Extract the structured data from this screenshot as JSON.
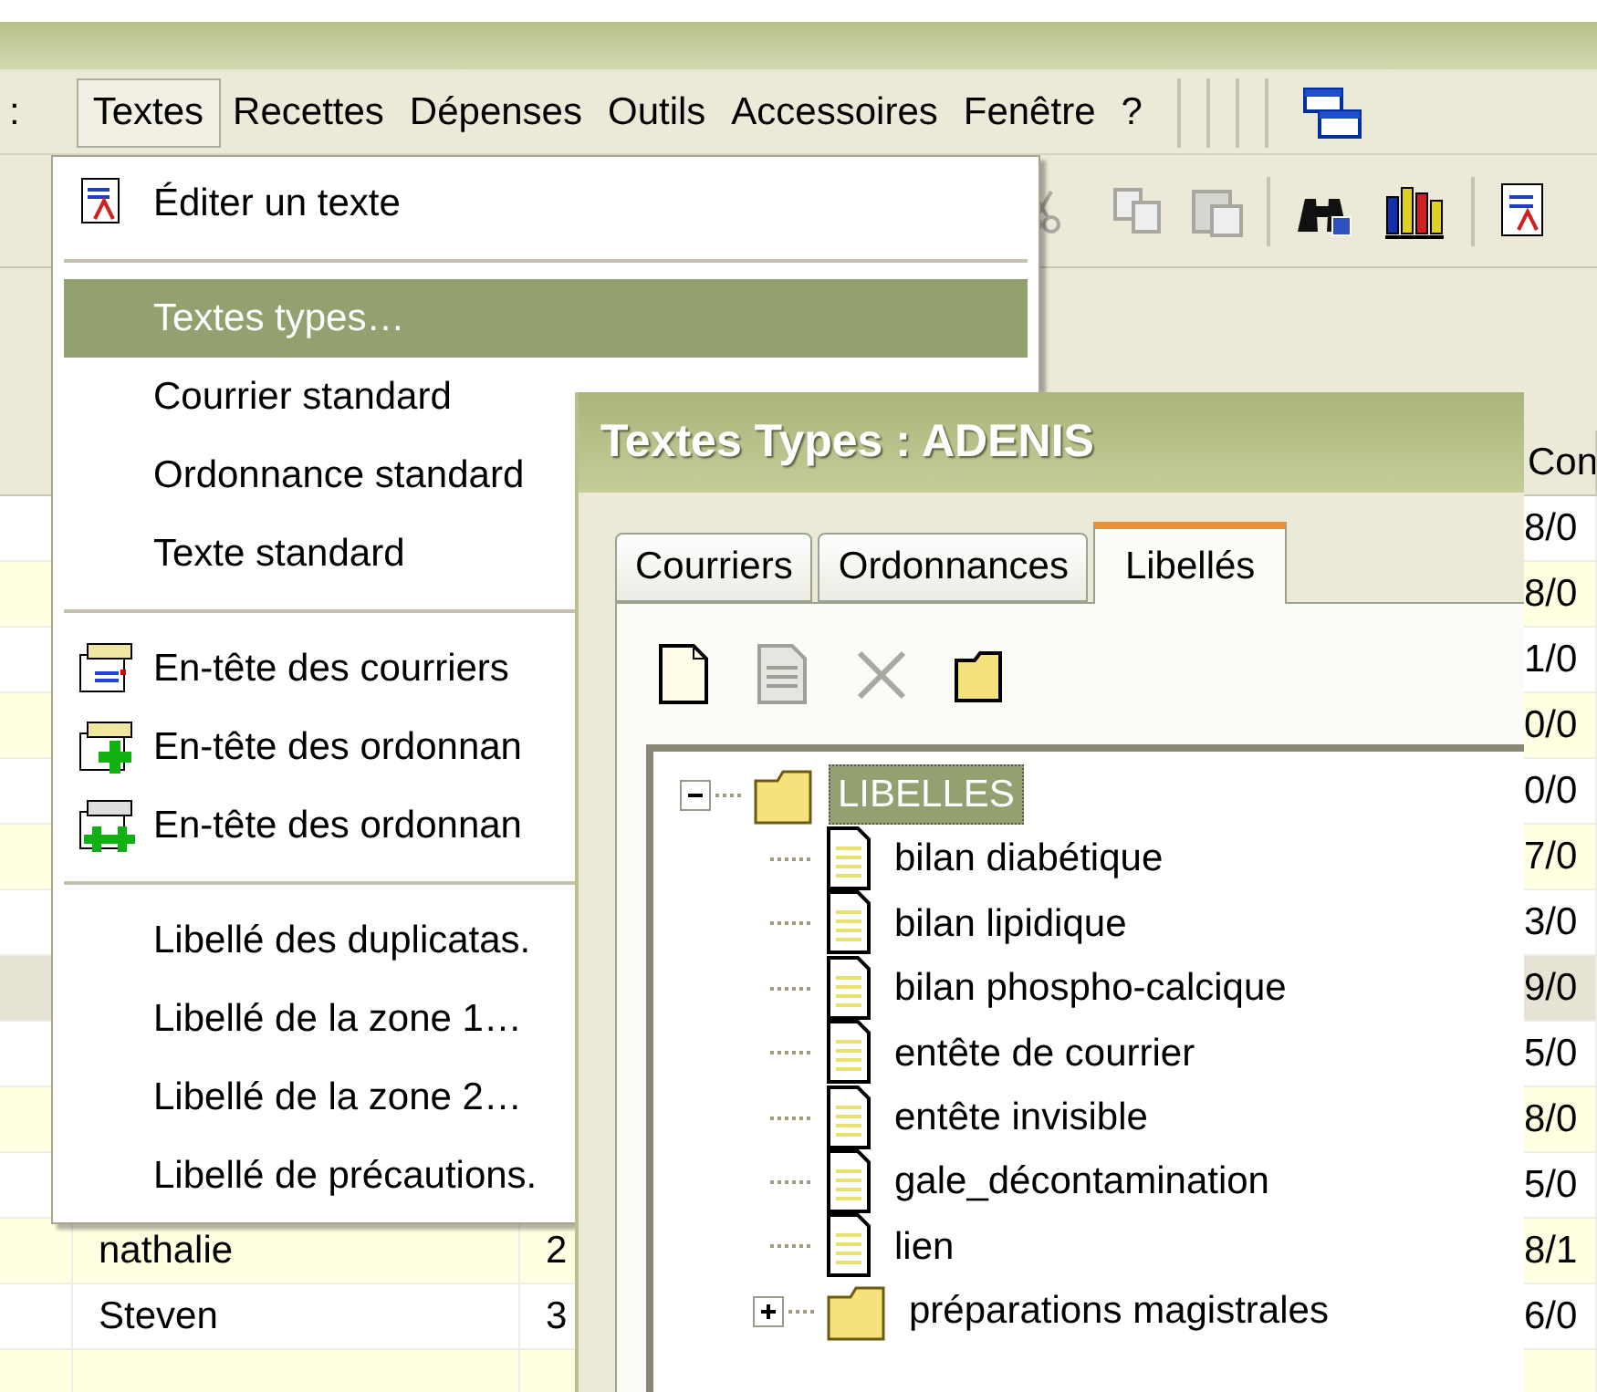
{
  "menubar": [
    {
      "label": ":",
      "open": false
    },
    {
      "label": "Textes",
      "open": true
    },
    {
      "label": "Recettes",
      "open": false
    },
    {
      "label": "Dépenses",
      "open": false
    },
    {
      "label": "Outils",
      "open": false
    },
    {
      "label": "Accessoires",
      "open": false
    },
    {
      "label": "Fenêtre",
      "open": false
    },
    {
      "label": "?",
      "open": false
    }
  ],
  "table": {
    "columns": [
      "",
      "",
      "",
      "",
      "Con"
    ],
    "rows": [
      {
        "cells": [
          "",
          "",
          "",
          "",
          "8/0"
        ],
        "highlighted": false,
        "selected": false
      },
      {
        "cells": [
          "",
          "",
          "",
          "",
          "8/0"
        ],
        "highlighted": true,
        "selected": false
      },
      {
        "cells": [
          "",
          "",
          "",
          "",
          "1/0"
        ],
        "highlighted": false,
        "selected": false
      },
      {
        "cells": [
          "",
          "",
          "",
          "",
          "0/0"
        ],
        "highlighted": true,
        "selected": false
      },
      {
        "cells": [
          "",
          "",
          "",
          "",
          "0/0"
        ],
        "highlighted": false,
        "selected": false
      },
      {
        "cells": [
          "",
          "",
          "",
          "",
          "7/0"
        ],
        "highlighted": true,
        "selected": false
      },
      {
        "cells": [
          "",
          "",
          "",
          "",
          "3/0"
        ],
        "highlighted": false,
        "selected": false
      },
      {
        "cells": [
          "",
          "",
          "",
          "",
          "9/0"
        ],
        "highlighted": false,
        "selected": true
      },
      {
        "cells": [
          "",
          "",
          "",
          "",
          "5/0"
        ],
        "highlighted": false,
        "selected": false
      },
      {
        "cells": [
          "",
          "",
          "",
          "",
          "8/0"
        ],
        "highlighted": true,
        "selected": false
      },
      {
        "cells": [
          "",
          "",
          "",
          "",
          "5/0"
        ],
        "highlighted": false,
        "selected": false
      },
      {
        "cells": [
          "",
          "nathalie",
          "2",
          "",
          "8/1"
        ],
        "highlighted": true,
        "selected": false
      },
      {
        "cells": [
          "",
          "Steven",
          "3",
          "",
          "6/0"
        ],
        "highlighted": false,
        "selected": false
      },
      {
        "cells": [
          "",
          "",
          "",
          "",
          ""
        ],
        "highlighted": true,
        "selected": false
      }
    ]
  },
  "menu": {
    "items": [
      {
        "kind": "document",
        "label": "Éditer un texte",
        "selected": false
      },
      {
        "kind": "separator"
      },
      {
        "kind": "item",
        "label": "Textes types…",
        "selected": true
      },
      {
        "kind": "item",
        "label": "Courrier standard",
        "selected": false
      },
      {
        "kind": "item",
        "label": "Ordonnance standard",
        "selected": false
      },
      {
        "kind": "item",
        "label": "Texte standard",
        "selected": false
      },
      {
        "kind": "separator"
      },
      {
        "kind": "header",
        "label": "En-tête des courriers",
        "selected": false
      },
      {
        "kind": "header_add",
        "label": "En-tête des ordonnan",
        "selected": false
      },
      {
        "kind": "header_add_double",
        "label": "En-tête des ordonnan",
        "selected": false
      },
      {
        "kind": "separator"
      },
      {
        "kind": "item",
        "label": "Libellé des duplicatas.",
        "selected": false
      },
      {
        "kind": "item",
        "label": "Libellé de la zone 1…",
        "selected": false
      },
      {
        "kind": "item",
        "label": "Libellé de la zone 2…",
        "selected": false
      },
      {
        "kind": "item",
        "label": "Libellé de précautions.",
        "selected": false
      }
    ]
  },
  "dialog": {
    "title": "Textes Types : ADENIS",
    "tabs": [
      {
        "label": "Courriers",
        "selected": false
      },
      {
        "label": "Ordonnances",
        "selected": false
      },
      {
        "label": "Libellés",
        "selected": true
      }
    ],
    "toolbar": [
      {
        "kind": "new",
        "disabled": false
      },
      {
        "kind": "document",
        "disabled": true
      },
      {
        "kind": "delete",
        "disabled": true
      },
      {
        "kind": "folder",
        "disabled": false
      }
    ],
    "tree": [
      {
        "kind": "folder",
        "label": "LIBELLES",
        "selected": true,
        "expanded": true,
        "children": [
          {
            "kind": "document",
            "label": "bilan diabétique",
            "selected": false
          },
          {
            "kind": "document",
            "label": "bilan lipidique",
            "selected": false
          },
          {
            "kind": "document",
            "label": "bilan phospho-calcique",
            "selected": false
          },
          {
            "kind": "document",
            "label": "entête de courrier",
            "selected": false
          },
          {
            "kind": "document",
            "label": "entête invisible",
            "selected": false
          },
          {
            "kind": "document",
            "label": "gale_décontamination",
            "selected": false
          },
          {
            "kind": "document",
            "label": "lien",
            "selected": false
          },
          {
            "kind": "folder",
            "label": "préparations magistrales",
            "selected": false,
            "expanded": false
          }
        ]
      }
    ]
  }
}
